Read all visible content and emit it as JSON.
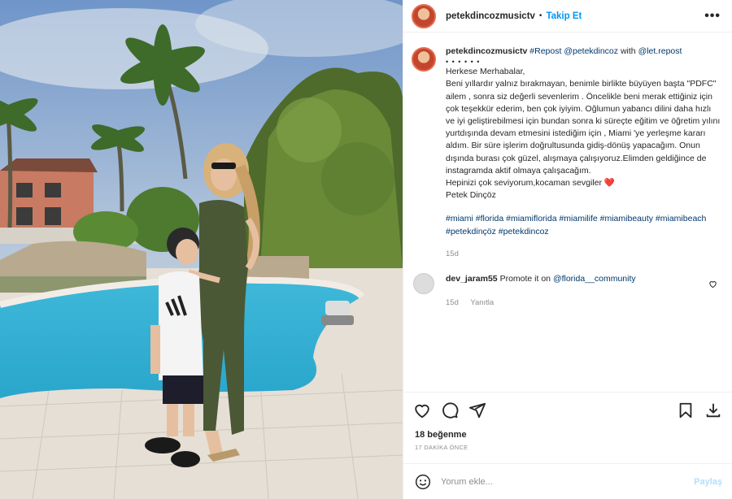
{
  "header": {
    "username": "petekdincozmusictv",
    "separator": "•",
    "follow_label": "Takip Et",
    "more_icon": "•••"
  },
  "caption": {
    "username": "petekdincozmusictv",
    "repost": "#Repost",
    "mention1": "@petekdincoz",
    "with": "with",
    "mention2": "@let.repost",
    "dots": "• • • • • •",
    "body": "Herkese Merhabalar,\nBeni yıllardır yalnız bırakmayan, benimle birlikte büyüyen başta \"PDFC\" ailem , sonra siz değerli sevenlerim . Öncelikle beni merak ettiğiniz için çok teşekkür ederim, ben çok iyiyim. Oğlumun yabancı dilini daha hızlı ve iyi geliştirebilmesi için bundan sonra ki süreçte eğitim ve öğretim yılını yurtdışında devam etmesini istediğim için , Miami 'ye yerleşme kararı aldım. Bir süre işlerim doğrultusunda gidiş-dönüş yapacağım. Onun dışında burası çok güzel, alışmaya çalışıyoruz.Elimden geldiğince de instagramda aktif olmaya çalışacağım.\nHepinizi çok seviyorum,kocaman sevgiler",
    "heart_emoji": "❤️",
    "signature": "Petek Dinçöz",
    "hashtags": "#miami #florida #miamiflorida #miamilife #miamibeauty #miamibeach #petekdinçöz #petekdincoz",
    "time": "15d"
  },
  "comment": {
    "username": "dev_jaram55",
    "text": "Promote it on",
    "mention": "@florida__community",
    "time": "15d",
    "reply_label": "Yanıtla",
    "like_icon": "heart-outline"
  },
  "actions": {
    "likes": "18 beğenme",
    "time_ago": "17 DAKİKA ÖNCE"
  },
  "add_comment": {
    "placeholder": "Yorum ekle...",
    "share_label": "Paylaş"
  }
}
